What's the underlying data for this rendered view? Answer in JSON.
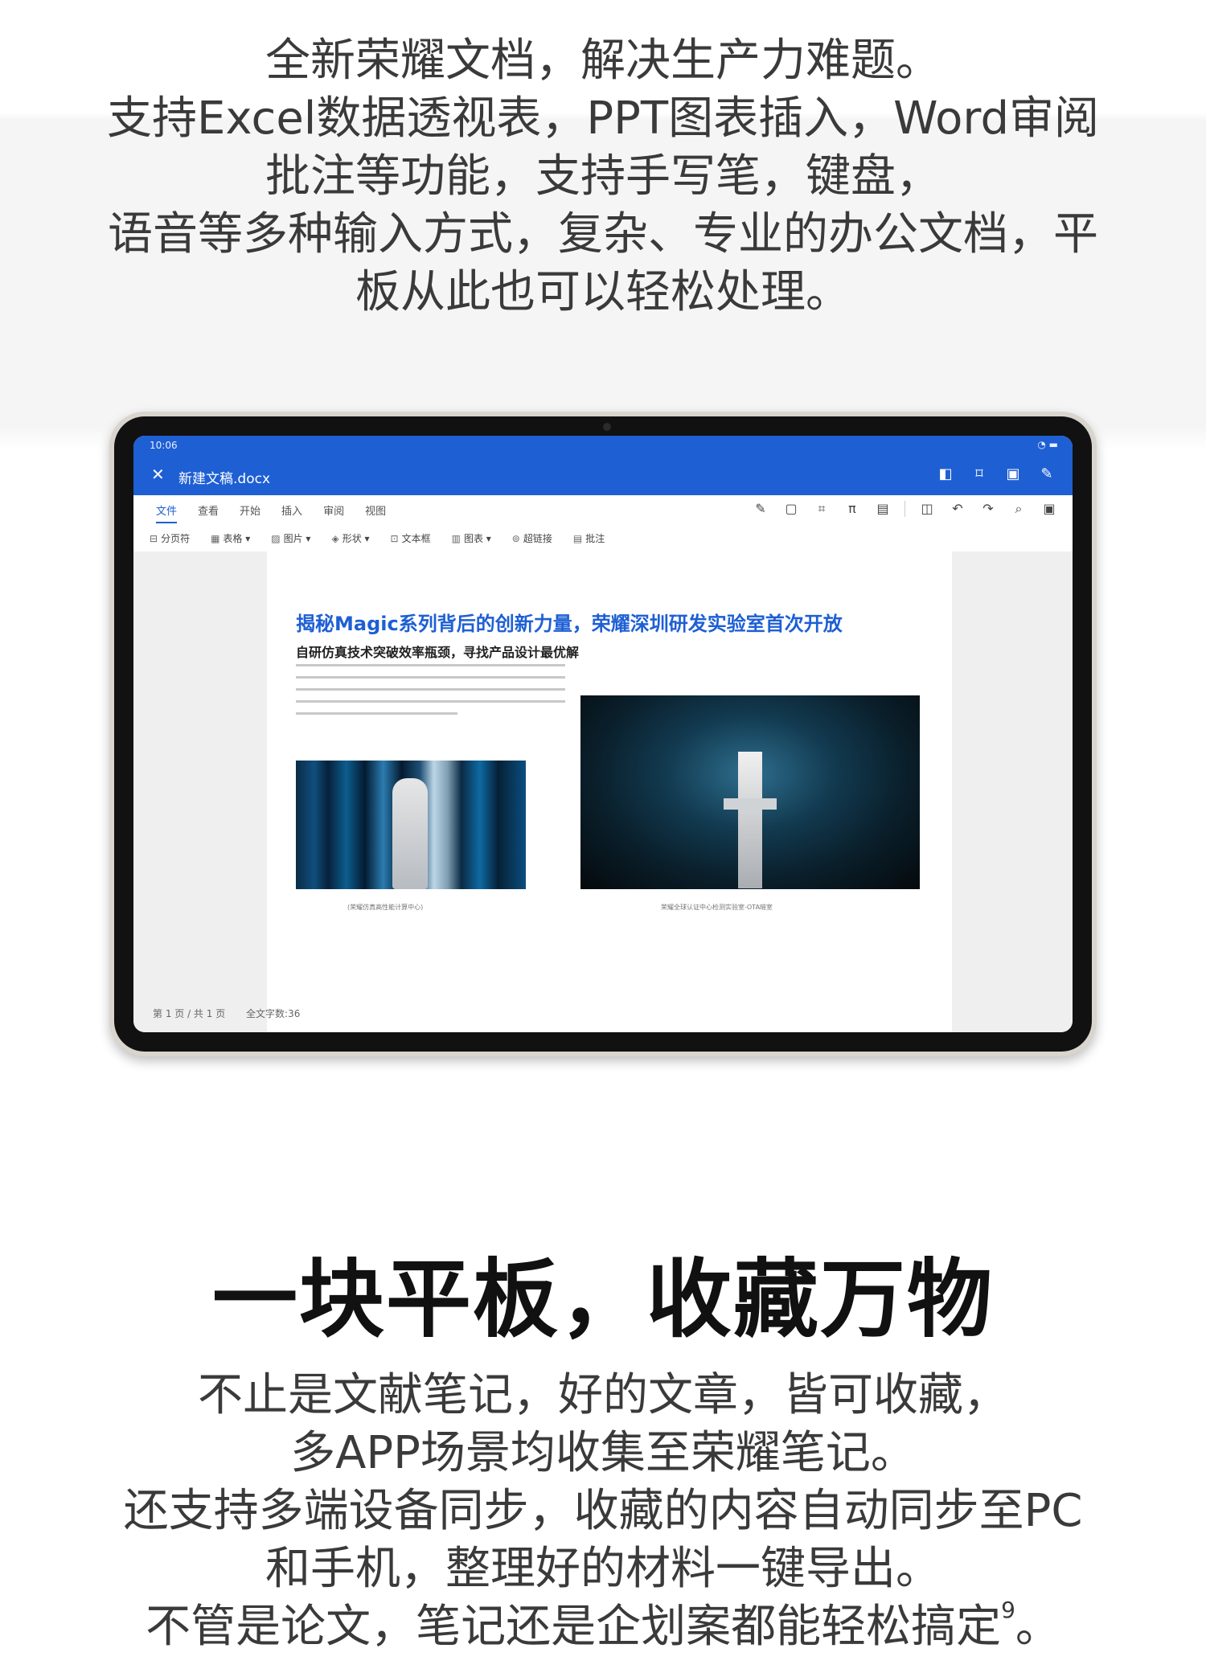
{
  "intro": {
    "lines": [
      "全新荣耀文档，解决生产力难题。",
      "支持Excel数据透视表，PPT图表插入，Word审阅",
      "批注等功能，支持手写笔，键盘，",
      "语音等多种输入方式，复杂、专业的办公文档，平",
      "板从此也可以轻松处理。"
    ]
  },
  "tablet": {
    "status_time": "10:06",
    "doc_title": "新建文稿.docx",
    "menu_tabs": [
      "文件",
      "查看",
      "开始",
      "插入",
      "审阅",
      "视图"
    ],
    "active_tab": "文件",
    "insert_items": [
      "分页符",
      "表格 ▾",
      "图片 ▾",
      "形状 ▾",
      "文本框",
      "图表 ▾",
      "超链接",
      "批注"
    ],
    "document": {
      "headline": "揭秘Magic系列背后的创新力量，荣耀深圳研发实验室首次开放",
      "subhead": "自研仿真技术突破效率瓶颈，寻找产品设计最优解",
      "caption1": "(荣耀仿真高性能计算中心)",
      "caption2": "荣耀全球认证中心检测实验室-OTA暗室"
    },
    "footer": {
      "page": "第 1 页 / 共 1 页",
      "words": "全文字数:36"
    }
  },
  "section_title": "一块平板，收藏万物",
  "outro": {
    "lines": [
      "不止是文献笔记，好的文章，皆可收藏，",
      "多APP场景均收集至荣耀笔记。",
      "还支持多端设备同步，收藏的内容自动同步至PC",
      "和手机，整理好的材料一键导出。",
      "不管是论文，笔记还是企划案都能轻松搞定"
    ],
    "footnote": "9",
    "last_punct": "。"
  },
  "colors": {
    "accent": "#1e5fd4",
    "headline": "#1e5fd4"
  }
}
